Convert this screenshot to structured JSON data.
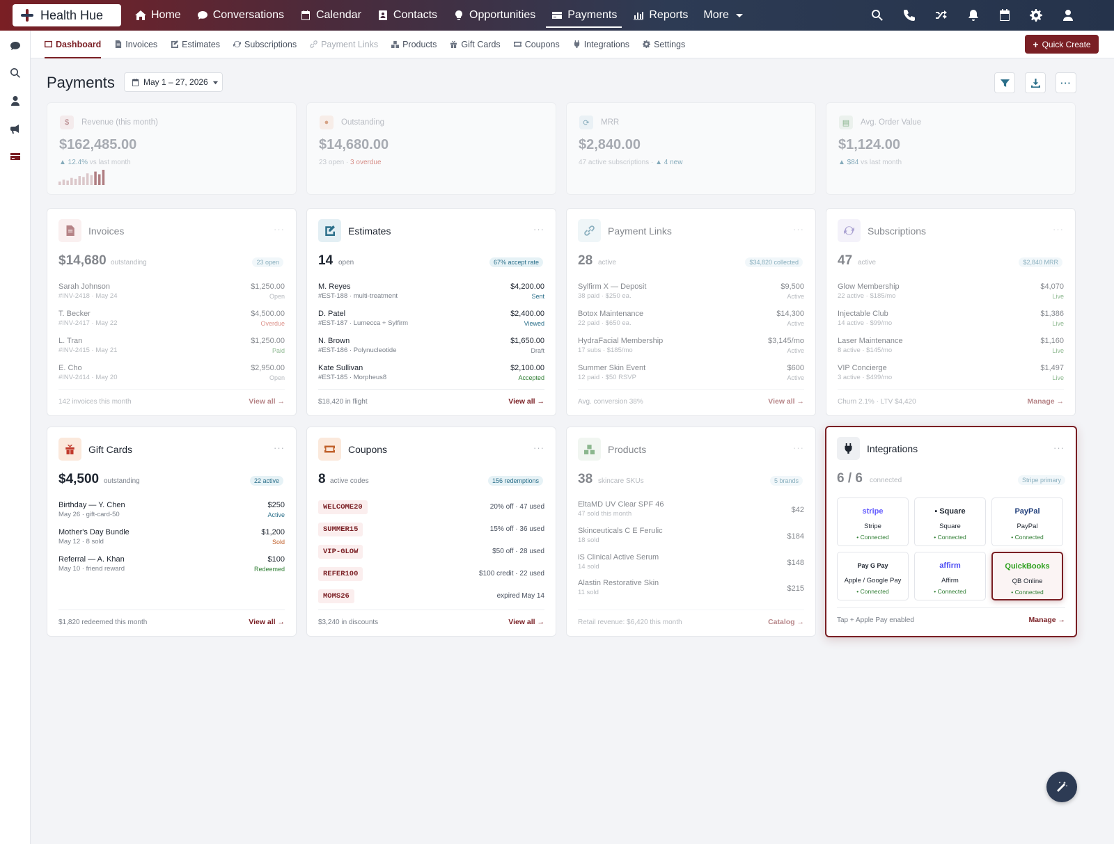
{
  "brand": {
    "name": "Health Hue"
  },
  "topnav": {
    "items": [
      {
        "label": "Home",
        "icon": "home-icon"
      },
      {
        "label": "Conversations",
        "icon": "chat-icon"
      },
      {
        "label": "Calendar",
        "icon": "calendar-icon"
      },
      {
        "label": "Contacts",
        "icon": "contacts-icon"
      },
      {
        "label": "Opportunities",
        "icon": "lightbulb-icon"
      },
      {
        "label": "Payments",
        "icon": "payments-icon",
        "active": true
      },
      {
        "label": "Reports",
        "icon": "chart-icon"
      },
      {
        "label": "More",
        "icon": "chevron-down-icon"
      }
    ]
  },
  "subnav": {
    "items": [
      {
        "label": "Dashboard",
        "active": true
      },
      {
        "label": "Invoices"
      },
      {
        "label": "Estimates"
      },
      {
        "label": "Subscriptions"
      },
      {
        "label": "Payment Links",
        "muted": true
      },
      {
        "label": "Products"
      },
      {
        "label": "Gift Cards"
      },
      {
        "label": "Coupons"
      },
      {
        "label": "Integrations"
      },
      {
        "label": "Settings"
      }
    ],
    "quick_create": "Quick Create"
  },
  "page": {
    "title": "Payments",
    "date_range": "May 1 – 27, 2026"
  },
  "kpis": [
    {
      "label": "Revenue (this month)",
      "value": "$162,485.00",
      "sub_a": "▲ 12.4%",
      "sub_b": " vs last month",
      "spark": [
        4,
        6,
        5,
        8,
        7,
        10,
        9,
        13,
        11,
        15,
        12,
        17
      ]
    },
    {
      "label": "Outstanding",
      "value": "$14,680.00",
      "sub_a": "23 open · ",
      "sub_b": "3 overdue"
    },
    {
      "label": "MRR",
      "value": "$2,840.00",
      "sub_a": "47 active subscriptions · ",
      "sub_b": "▲ 4 new"
    },
    {
      "label": "Avg. Order Value",
      "value": "$1,124.00",
      "sub_a": "▲ $84",
      "sub_b": " vs last month"
    }
  ],
  "invoices": {
    "title": "Invoices",
    "big": "$14,680",
    "big_sub": "outstanding",
    "badge": "23 open",
    "rows": [
      {
        "name": "Sarah Johnson",
        "sub": "#INV-2418 · May 24",
        "amount": "$1,250.00",
        "status": "Open"
      },
      {
        "name": "T. Becker",
        "sub": "#INV-2417 · May 22",
        "amount": "$4,500.00",
        "status": "Overdue"
      },
      {
        "name": "L. Tran",
        "sub": "#INV-2415 · May 21",
        "amount": "$1,250.00",
        "status": "Paid"
      },
      {
        "name": "E. Cho",
        "sub": "#INV-2414 · May 20",
        "amount": "$2,950.00",
        "status": "Open"
      }
    ],
    "foot": "142 invoices this month",
    "link": "View all →"
  },
  "estimates": {
    "title": "Estimates",
    "big": "14",
    "big_sub": "open",
    "badge": "67% accept rate",
    "rows": [
      {
        "name": "M. Reyes",
        "sub": "#EST-188 · multi-treatment",
        "amount": "$4,200.00",
        "status": "Sent"
      },
      {
        "name": "D. Patel",
        "sub": "#EST-187 · Lumecca + Sylfirm",
        "amount": "$2,400.00",
        "status": "Viewed"
      },
      {
        "name": "N. Brown",
        "sub": "#EST-186 · Polynucleotide",
        "amount": "$1,650.00",
        "status": "Draft"
      },
      {
        "name": "Kate Sullivan",
        "sub": "#EST-185 · Morpheus8",
        "amount": "$2,100.00",
        "status": "Accepted"
      }
    ],
    "foot": "$18,420 in flight",
    "link": "View all →"
  },
  "payment_links": {
    "title": "Payment Links",
    "big": "28",
    "big_sub": "active",
    "badge": "$34,820 collected",
    "rows": [
      {
        "name": "Sylfirm X — Deposit",
        "sub": "38 paid · $250 ea.",
        "amount": "$9,500",
        "status": "Active"
      },
      {
        "name": "Botox Maintenance",
        "sub": "22 paid · $650 ea.",
        "amount": "$14,300",
        "status": "Active"
      },
      {
        "name": "HydraFacial Membership",
        "sub": "17 subs · $185/mo",
        "amount": "$3,145/mo",
        "status": "Active"
      },
      {
        "name": "Summer Skin Event",
        "sub": "12 paid · $50 RSVP",
        "amount": "$600",
        "status": "Active"
      }
    ],
    "foot": "Avg. conversion 38%",
    "link": "View all →"
  },
  "subscriptions": {
    "title": "Subscriptions",
    "big": "47",
    "big_sub": "active",
    "badge": "$2,840 MRR",
    "rows": [
      {
        "name": "Glow Membership",
        "sub": "22 active · $185/mo",
        "amount": "$4,070",
        "status": "Live"
      },
      {
        "name": "Injectable Club",
        "sub": "14 active · $99/mo",
        "amount": "$1,386",
        "status": "Live"
      },
      {
        "name": "Laser Maintenance",
        "sub": "8 active · $145/mo",
        "amount": "$1,160",
        "status": "Live"
      },
      {
        "name": "VIP Concierge",
        "sub": "3 active · $499/mo",
        "amount": "$1,497",
        "status": "Live"
      }
    ],
    "foot": "Churn 2.1% · LTV $4,420",
    "link": "Manage →"
  },
  "gift_cards": {
    "title": "Gift Cards",
    "big": "$4,500",
    "big_sub": "outstanding",
    "badge": "22 active",
    "rows": [
      {
        "name": "Birthday — Y. Chen",
        "sub": "May 26 · gift-card-50",
        "amount": "$250",
        "status": "Active"
      },
      {
        "name": "Mother's Day Bundle",
        "sub": "May 12 · 8 sold",
        "amount": "$1,200",
        "status": "Sold"
      },
      {
        "name": "Referral — A. Khan",
        "sub": "May 10 · friend reward",
        "amount": "$100",
        "status": "Redeemed"
      }
    ],
    "foot": "$1,820 redeemed this month",
    "link": "View all →"
  },
  "coupons": {
    "title": "Coupons",
    "big": "8",
    "big_sub": "active codes",
    "badge": "156 redemptions",
    "rows": [
      {
        "code": "WELCOME20",
        "desc": "20% off · 47 used"
      },
      {
        "code": "SUMMER15",
        "desc": "15% off · 36 used"
      },
      {
        "code": "VIP-GLOW",
        "desc": "$50 off · 28 used"
      },
      {
        "code": "REFER100",
        "desc": "$100 credit · 22 used"
      },
      {
        "code": "MOMS26",
        "desc": "expired May 14"
      }
    ],
    "foot": "$3,240 in discounts",
    "link": "View all →"
  },
  "products": {
    "title": "Products",
    "big": "38",
    "big_sub": "skincare SKUs",
    "badge": "5 brands",
    "rows": [
      {
        "name": "EltaMD UV Clear SPF 46",
        "sub": "47 sold this month",
        "amount": "$42"
      },
      {
        "name": "Skinceuticals C E Ferulic",
        "sub": "18 sold",
        "amount": "$184"
      },
      {
        "name": "iS Clinical Active Serum",
        "sub": "14 sold",
        "amount": "$148"
      },
      {
        "name": "Alastin Restorative Skin",
        "sub": "11 sold",
        "amount": "$215"
      }
    ],
    "foot": "Retail revenue: $6,420 this month",
    "link": "Catalog →"
  },
  "integrations": {
    "title": "Integrations",
    "big": "6 / 6",
    "big_sub": "connected",
    "badge": "Stripe primary",
    "tiles": [
      {
        "logo": "stripe",
        "name": "Stripe",
        "status": "• Connected",
        "color": "#635bff"
      },
      {
        "logo": "▪ Square",
        "name": "Square",
        "status": "• Connected",
        "color": "#1e2530"
      },
      {
        "logo": "PayPal",
        "name": "PayPal",
        "status": "• Connected",
        "color": "#1f3d7a"
      },
      {
        "logo": " Pay  G Pay",
        "name": "Apple / Google Pay",
        "status": "• Connected",
        "color": "#1e2530"
      },
      {
        "logo": "affirm",
        "name": "Affirm",
        "status": "• Connected",
        "color": "#4a4af4"
      },
      {
        "logo": "QuickBooks",
        "name": "QB Online",
        "status": "• Connected",
        "color": "#2ca01c"
      }
    ],
    "foot": "Tap + Apple Pay enabled",
    "link": "Manage →"
  }
}
